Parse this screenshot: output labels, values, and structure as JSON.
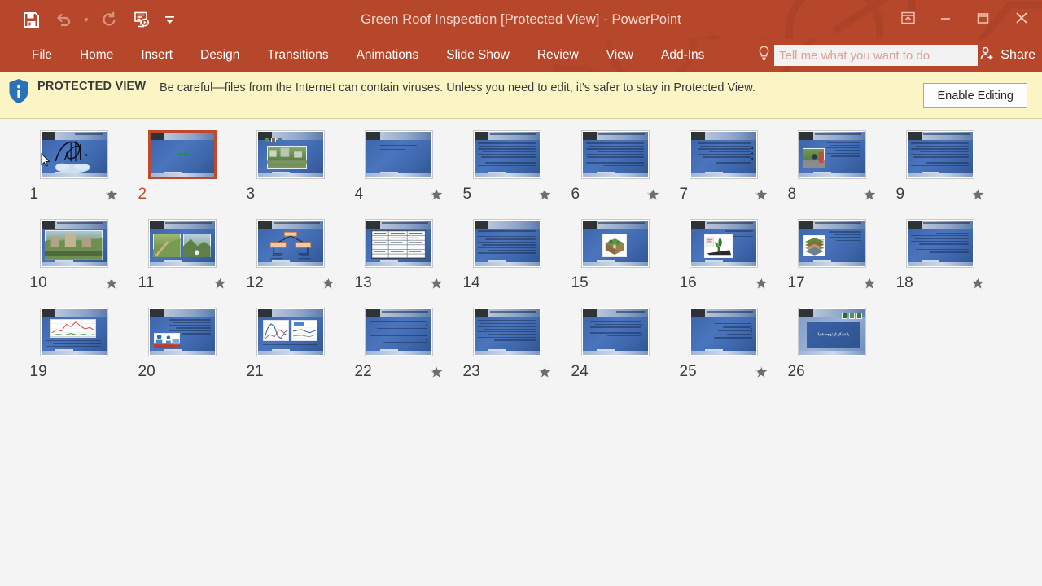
{
  "window": {
    "title": "Green Roof Inspection [Protected View] - PowerPoint",
    "app_name": "PowerPoint",
    "accent_color": "#b7472a"
  },
  "quick_access_toolbar": {
    "items": [
      {
        "name": "save-icon",
        "label": "Save",
        "enabled": true
      },
      {
        "name": "undo-icon",
        "label": "Undo",
        "enabled": false
      },
      {
        "name": "undo-dropdown-icon",
        "label": "Undo options",
        "enabled": false
      },
      {
        "name": "redo-icon",
        "label": "Redo",
        "enabled": false
      },
      {
        "name": "start-from-beginning-icon",
        "label": "Start From Beginning",
        "enabled": true
      },
      {
        "name": "customize-qat-icon",
        "label": "Customize Quick Access Toolbar",
        "enabled": true
      }
    ]
  },
  "window_controls": [
    {
      "name": "ribbon-display-options-icon",
      "label": "Ribbon Display Options"
    },
    {
      "name": "minimize-icon",
      "label": "Minimize"
    },
    {
      "name": "restore-icon",
      "label": "Restore Down"
    },
    {
      "name": "close-icon",
      "label": "Close"
    }
  ],
  "ribbon": {
    "tabs": [
      {
        "label": "File"
      },
      {
        "label": "Home"
      },
      {
        "label": "Insert"
      },
      {
        "label": "Design"
      },
      {
        "label": "Transitions"
      },
      {
        "label": "Animations"
      },
      {
        "label": "Slide Show"
      },
      {
        "label": "Review"
      },
      {
        "label": "View"
      },
      {
        "label": "Add-Ins"
      }
    ],
    "tell_me": {
      "placeholder": "Tell me what you want to do",
      "value": ""
    },
    "share_label": "Share"
  },
  "protected_view": {
    "label": "PROTECTED VIEW",
    "message": "Be careful—files from the Internet can contain viruses. Unless you need to edit, it's safer to stay in Protected View.",
    "enable_editing_label": "Enable Editing",
    "bar_color": "#fbf4c4"
  },
  "slide_sorter": {
    "selected_slide": 2,
    "slides": [
      {
        "number": "1",
        "starred": true,
        "kind": "calligraphy",
        "title": ""
      },
      {
        "number": "2",
        "starred": false,
        "kind": "title",
        "title": "بام سبز"
      },
      {
        "number": "3",
        "starred": false,
        "kind": "photo-wide",
        "title": ""
      },
      {
        "number": "4",
        "starred": true,
        "kind": "two-lines",
        "title": ""
      },
      {
        "number": "5",
        "starred": true,
        "kind": "text",
        "title": ""
      },
      {
        "number": "6",
        "starred": true,
        "kind": "text",
        "title": ""
      },
      {
        "number": "7",
        "starred": true,
        "kind": "text",
        "title": ""
      },
      {
        "number": "8",
        "starred": true,
        "kind": "photo-left",
        "title": ""
      },
      {
        "number": "9",
        "starred": true,
        "kind": "text",
        "title": ""
      },
      {
        "number": "10",
        "starred": true,
        "kind": "photo-big",
        "title": ""
      },
      {
        "number": "11",
        "starred": true,
        "kind": "photo-two",
        "title": ""
      },
      {
        "number": "12",
        "starred": true,
        "kind": "diagram",
        "title": ""
      },
      {
        "number": "13",
        "starred": true,
        "kind": "table",
        "title": ""
      },
      {
        "number": "14",
        "starred": false,
        "kind": "text",
        "title": ""
      },
      {
        "number": "15",
        "starred": false,
        "kind": "photo-center",
        "title": ""
      },
      {
        "number": "16",
        "starred": true,
        "kind": "photo-center",
        "title": ""
      },
      {
        "number": "17",
        "starred": true,
        "kind": "photo-left",
        "title": ""
      },
      {
        "number": "18",
        "starred": true,
        "kind": "text",
        "title": ""
      },
      {
        "number": "19",
        "starred": false,
        "kind": "chart",
        "title": ""
      },
      {
        "number": "20",
        "starred": false,
        "kind": "photo-left",
        "title": ""
      },
      {
        "number": "21",
        "starred": false,
        "kind": "chart-two",
        "title": ""
      },
      {
        "number": "22",
        "starred": true,
        "kind": "bullets",
        "title": ""
      },
      {
        "number": "23",
        "starred": true,
        "kind": "text",
        "title": ""
      },
      {
        "number": "24",
        "starred": false,
        "kind": "text",
        "title": ""
      },
      {
        "number": "25",
        "starred": true,
        "kind": "bullets",
        "title": ""
      },
      {
        "number": "26",
        "starred": false,
        "kind": "end",
        "title": "با تشکر از توجه شما"
      }
    ]
  }
}
